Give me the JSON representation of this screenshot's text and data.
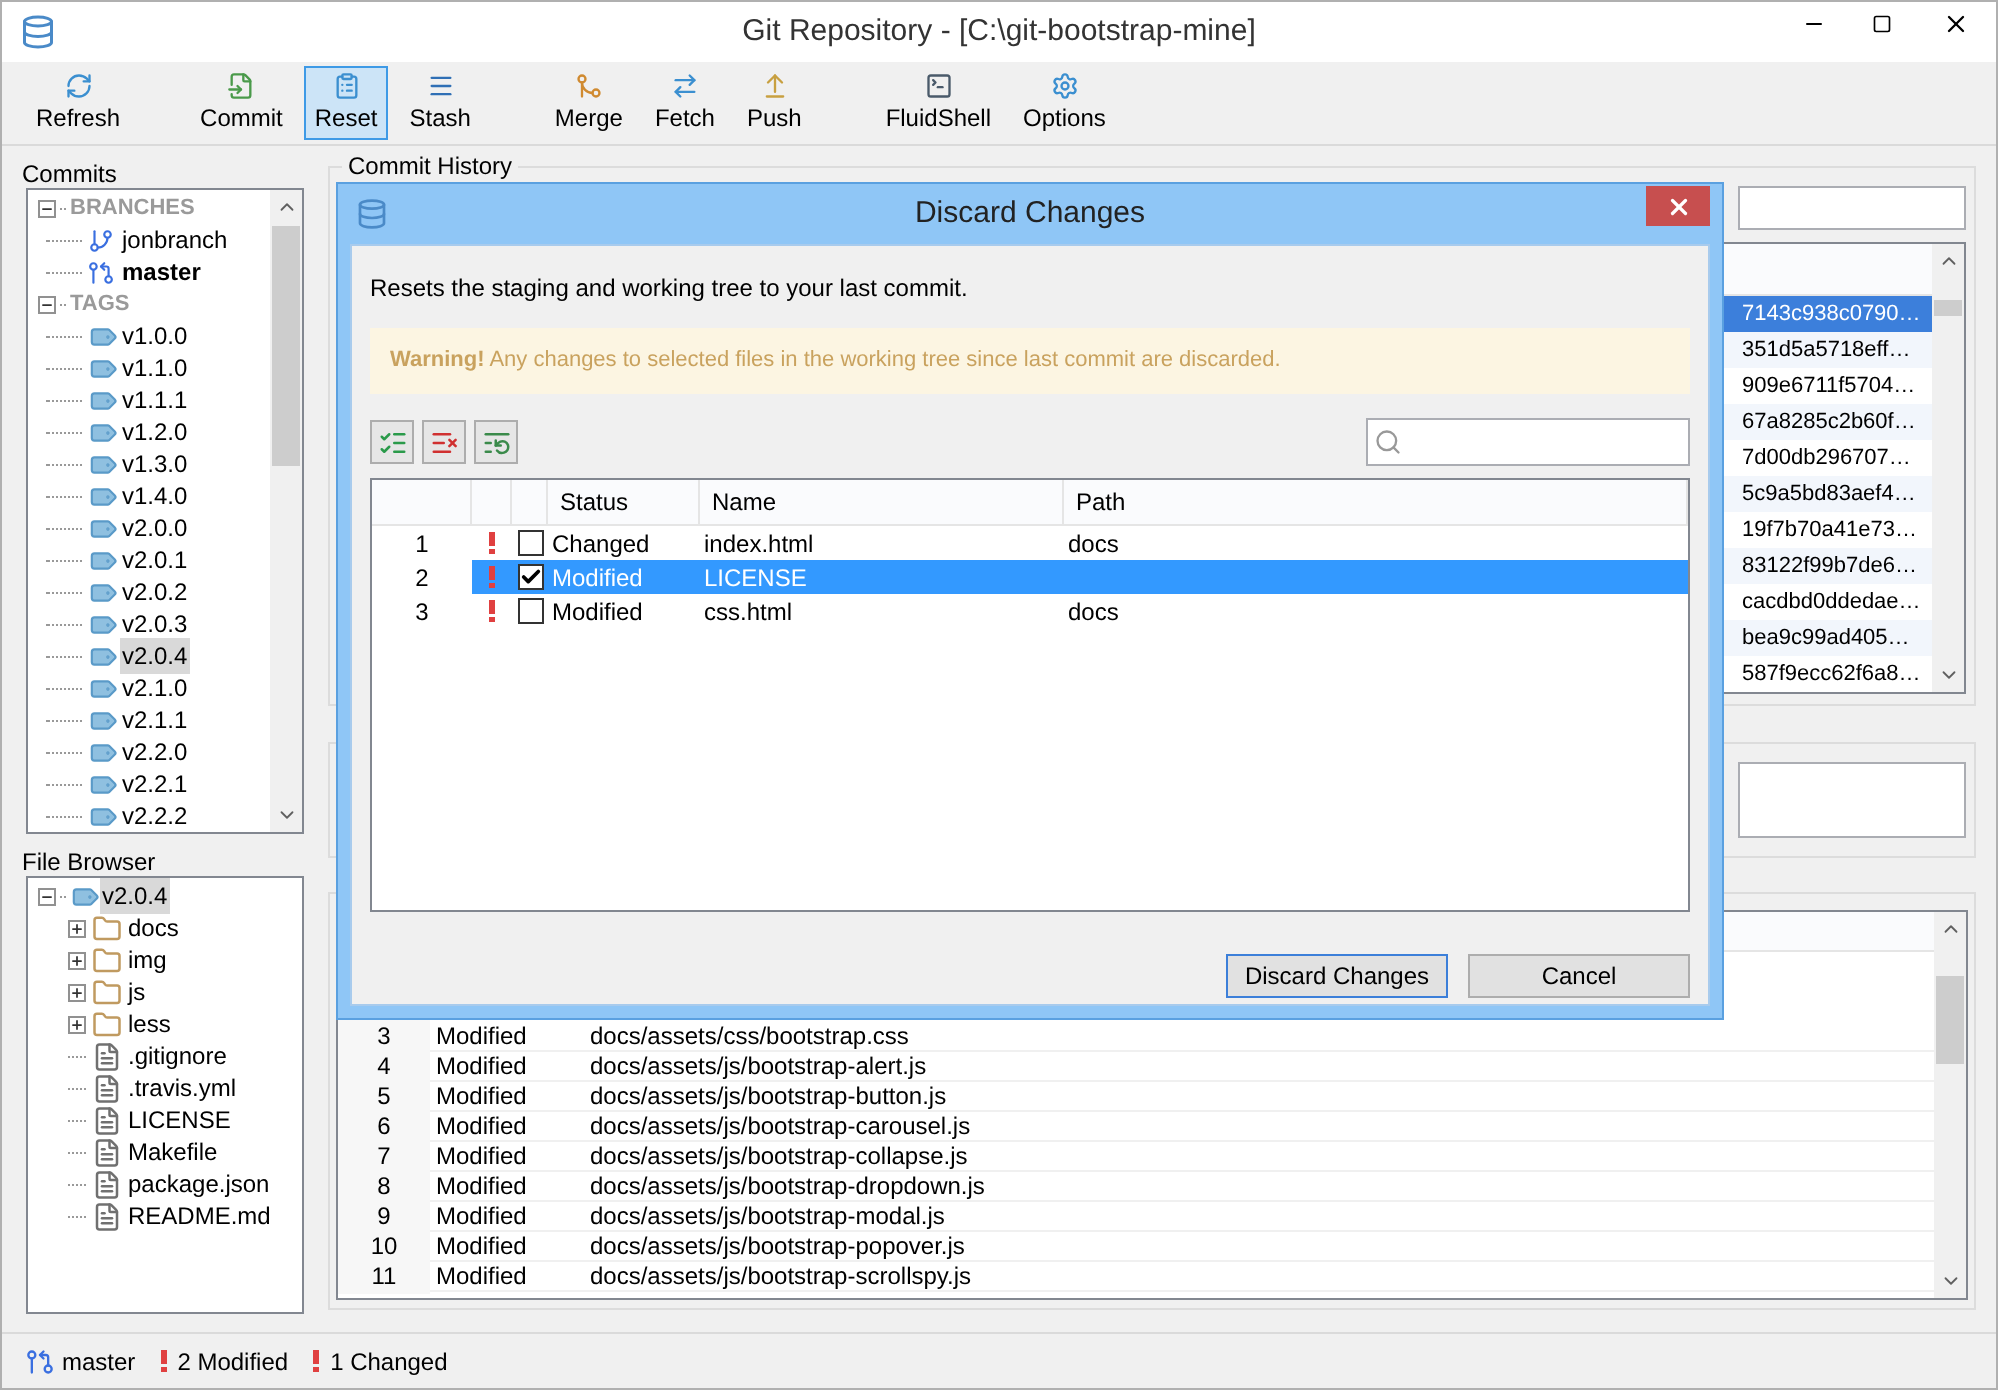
{
  "window": {
    "title": "Git Repository - [C:\\git-bootstrap-mine]"
  },
  "toolbar": [
    [
      {
        "label": "Refresh",
        "selected": false
      }
    ],
    [
      {
        "label": "Commit",
        "selected": false
      },
      {
        "label": "Reset",
        "selected": true
      },
      {
        "label": "Stash",
        "selected": false
      }
    ],
    [
      {
        "label": "Merge",
        "selected": false
      },
      {
        "label": "Fetch",
        "selected": false
      },
      {
        "label": "Push",
        "selected": false
      }
    ],
    [
      {
        "label": "FluidShell",
        "selected": false
      },
      {
        "label": "Options",
        "selected": false
      }
    ]
  ],
  "commits_panel": {
    "title": "Commits",
    "tree": [
      {
        "label": "BRANCHES",
        "expanded": true,
        "children": [
          {
            "label": "jonbranch",
            "kind": "branch",
            "current": false,
            "selected": false
          },
          {
            "label": "master",
            "kind": "branch",
            "current": true,
            "selected": false
          }
        ]
      },
      {
        "label": "TAGS",
        "expanded": true,
        "children": [
          {
            "label": "v1.0.0",
            "kind": "tag",
            "selected": false
          },
          {
            "label": "v1.1.0",
            "kind": "tag",
            "selected": false
          },
          {
            "label": "v1.1.1",
            "kind": "tag",
            "selected": false
          },
          {
            "label": "v1.2.0",
            "kind": "tag",
            "selected": false
          },
          {
            "label": "v1.3.0",
            "kind": "tag",
            "selected": false
          },
          {
            "label": "v1.4.0",
            "kind": "tag",
            "selected": false
          },
          {
            "label": "v2.0.0",
            "kind": "tag",
            "selected": false
          },
          {
            "label": "v2.0.1",
            "kind": "tag",
            "selected": false
          },
          {
            "label": "v2.0.2",
            "kind": "tag",
            "selected": false
          },
          {
            "label": "v2.0.3",
            "kind": "tag",
            "selected": false
          },
          {
            "label": "v2.0.4",
            "kind": "tag",
            "selected": true
          },
          {
            "label": "v2.1.0",
            "kind": "tag",
            "selected": false
          },
          {
            "label": "v2.1.1",
            "kind": "tag",
            "selected": false
          },
          {
            "label": "v2.2.0",
            "kind": "tag",
            "selected": false
          },
          {
            "label": "v2.2.1",
            "kind": "tag",
            "selected": false
          },
          {
            "label": "v2.2.2",
            "kind": "tag",
            "selected": false
          }
        ]
      }
    ]
  },
  "file_browser": {
    "title": "File Browser",
    "root": {
      "label": "v2.0.4",
      "selected": true,
      "expanded": true,
      "children": [
        {
          "label": "docs",
          "kind": "folder",
          "expanded": false
        },
        {
          "label": "img",
          "kind": "folder",
          "expanded": false
        },
        {
          "label": "js",
          "kind": "folder",
          "expanded": false
        },
        {
          "label": "less",
          "kind": "folder",
          "expanded": false
        },
        {
          "label": ".gitignore",
          "kind": "file"
        },
        {
          "label": ".travis.yml",
          "kind": "file"
        },
        {
          "label": "LICENSE",
          "kind": "file"
        },
        {
          "label": "Makefile",
          "kind": "file"
        },
        {
          "label": "package.json",
          "kind": "file"
        },
        {
          "label": "README.md",
          "kind": "file"
        }
      ]
    }
  },
  "commit_history": {
    "title": "Commit History",
    "hashes": [
      {
        "text": "7143c938c0790…",
        "selected": true
      },
      {
        "text": "351d5a5718eff…",
        "selected": false
      },
      {
        "text": "909e6711f5704…",
        "selected": false
      },
      {
        "text": "67a8285c2b60f…",
        "selected": false
      },
      {
        "text": "7d00db296707…",
        "selected": false
      },
      {
        "text": "5c9a5bd83aef4…",
        "selected": false
      },
      {
        "text": "19f7b70a41e73…",
        "selected": false
      },
      {
        "text": "83122f99b7de6…",
        "selected": false
      },
      {
        "text": "cacdbd0ddedae…",
        "selected": false
      },
      {
        "text": "bea9c99ad405…",
        "selected": false
      },
      {
        "text": "587f9ecc62f6a8…",
        "selected": false
      }
    ]
  },
  "changes_table": {
    "rows": [
      {
        "number": "3",
        "status": "Modified",
        "path": "docs/assets/css/bootstrap.css"
      },
      {
        "number": "4",
        "status": "Modified",
        "path": "docs/assets/js/bootstrap-alert.js"
      },
      {
        "number": "5",
        "status": "Modified",
        "path": "docs/assets/js/bootstrap-button.js"
      },
      {
        "number": "6",
        "status": "Modified",
        "path": "docs/assets/js/bootstrap-carousel.js"
      },
      {
        "number": "7",
        "status": "Modified",
        "path": "docs/assets/js/bootstrap-collapse.js"
      },
      {
        "number": "8",
        "status": "Modified",
        "path": "docs/assets/js/bootstrap-dropdown.js"
      },
      {
        "number": "9",
        "status": "Modified",
        "path": "docs/assets/js/bootstrap-modal.js"
      },
      {
        "number": "10",
        "status": "Modified",
        "path": "docs/assets/js/bootstrap-popover.js"
      },
      {
        "number": "11",
        "status": "Modified",
        "path": "docs/assets/js/bootstrap-scrollspy.js"
      }
    ]
  },
  "status_bar": {
    "branch": "master",
    "items": [
      "2 Modified",
      "1 Changed"
    ]
  },
  "dialog": {
    "title": "Discard Changes",
    "description": "Resets the staging and working tree to your last commit.",
    "warning": "**Warning!** Any changes to selected files in the working tree since last commit are discarded.",
    "columns": [
      "Status",
      "Name",
      "Path"
    ],
    "rows": [
      {
        "number": "1",
        "status": "Changed",
        "name": "index.html",
        "path": "docs",
        "checked": false,
        "selected": false
      },
      {
        "number": "2",
        "status": "Modified",
        "name": "LICENSE",
        "checked": true,
        "selected": true
      },
      {
        "number": "3",
        "status": "Modified",
        "name": "css.html",
        "path": "docs",
        "checked": false,
        "selected": false
      }
    ],
    "buttons": [
      {
        "label": "Discard Changes",
        "kind": "default"
      },
      {
        "label": "Cancel",
        "kind": "normal"
      }
    ]
  }
}
